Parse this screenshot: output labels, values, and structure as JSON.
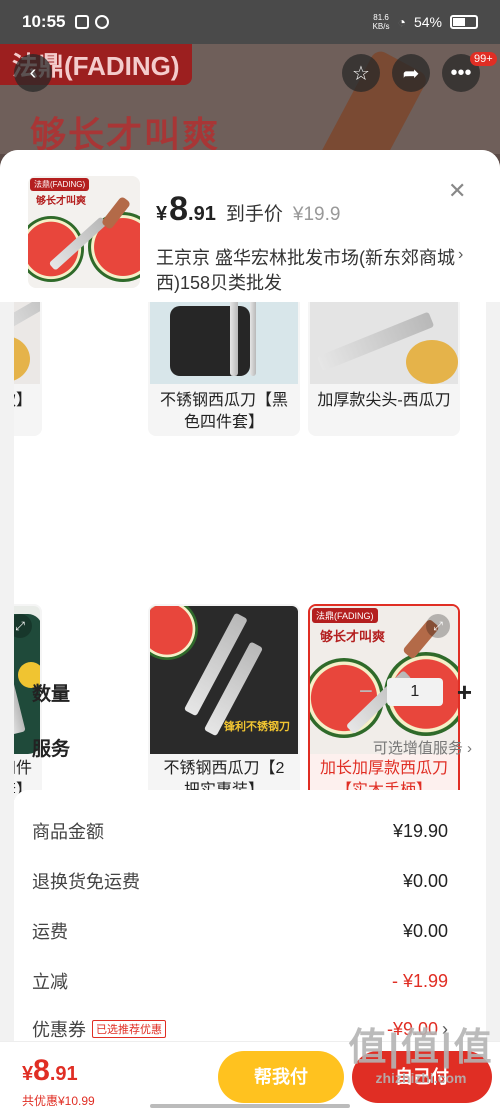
{
  "status_bar": {
    "time": "10:55",
    "speed_top": "81.6",
    "speed_unit": "KB/s",
    "battery": "54%"
  },
  "background": {
    "brand": "法鼎(FADING)",
    "slogan": "够长才叫爽",
    "cart_badge": "99+"
  },
  "product": {
    "thumb_brand": "法鼎(FADING)",
    "thumb_slogan": "够长才叫爽",
    "price_yen": "¥",
    "price_int": "8",
    "price_dec": ".91",
    "price_tag": "到手价",
    "original_price": "¥19.9",
    "shop": "王京京  盛华宏林批发市场(新东郊商城西)158贝类批发"
  },
  "options": [
    {
      "label": "钢-西瓜刀【薄款】"
    },
    {
      "label": "不锈钢西瓜刀【黑色四件套】"
    },
    {
      "label": "加厚款尖头-西瓜刀"
    },
    {
      "label": "厚款西瓜刀色四件套】"
    },
    {
      "label": "不锈钢西瓜刀【2把实惠装】",
      "img_text": "锋利不锈钢刀"
    },
    {
      "label": "加长加厚款西瓜刀【实木手柄】",
      "selected": true,
      "img_brand": "法鼎(FADING)",
      "img_slogan": "够长才叫爽"
    }
  ],
  "quantity": {
    "label": "数量",
    "value": "1"
  },
  "service": {
    "label": "服务",
    "link": "可选增值服务"
  },
  "summary": [
    {
      "label": "商品金额",
      "value": "¥19.90"
    },
    {
      "label": "退换货免运费",
      "value": "¥0.00"
    },
    {
      "label": "运费",
      "value": "¥0.00"
    },
    {
      "label": "立减",
      "value": "- ¥1.99"
    },
    {
      "label": "优惠券",
      "value": "-¥9.00",
      "tag": "已选推荐优惠"
    }
  ],
  "bottom": {
    "yen": "¥",
    "price_int": "8",
    "price_dec": ".91",
    "total_discount": "共优惠¥10.99",
    "help_pay": "帮我付",
    "self_pay": "自己付"
  },
  "watermark": {
    "line1": "值|值|值",
    "line2": "zhizhizhi.com"
  },
  "colors": {
    "accent": "#e02e24",
    "help_button": "#ffc21f"
  }
}
